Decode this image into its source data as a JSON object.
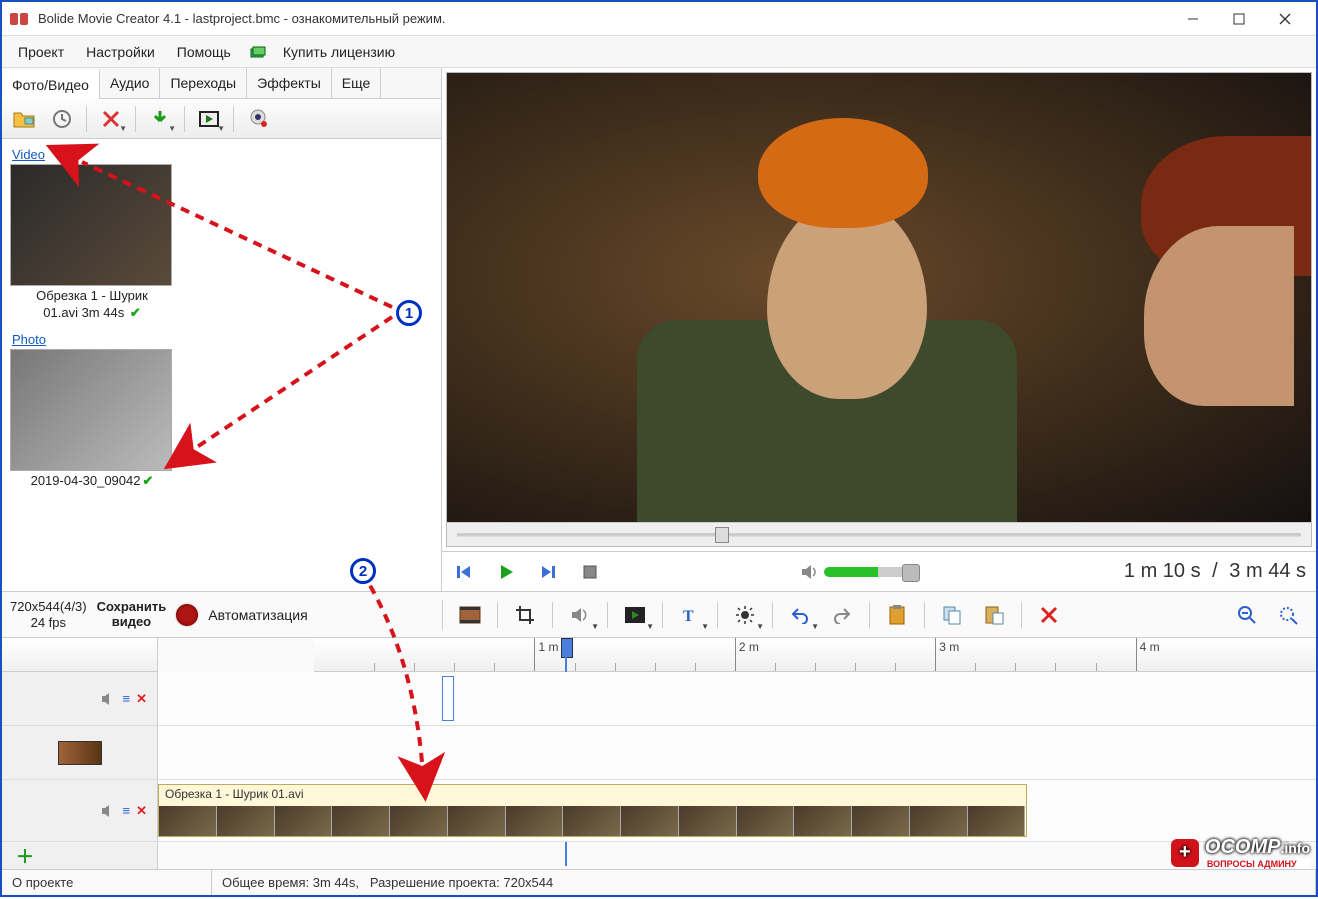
{
  "title": "Bolide Movie Creator 4.1 - lastproject.bmc  - ознакомительный режим.",
  "menu": {
    "project": "Проект",
    "settings": "Настройки",
    "help": "Помощь",
    "buy": "Купить лицензию"
  },
  "tabs": {
    "photo_video": "Фото/Видео",
    "audio": "Аудио",
    "transitions": "Переходы",
    "effects": "Эффекты",
    "more": "Еще"
  },
  "media": {
    "video_header": "Video",
    "photo_header": "Photo",
    "video_item": {
      "line1": "Обрезка 1 - Шурик",
      "line2": "01.avi 3m 44s"
    },
    "photo_item": {
      "caption": "2019-04-30_09042"
    }
  },
  "playback": {
    "current": "1 m 10 s",
    "sep": "/",
    "total": "3 m 44 s"
  },
  "project_info": {
    "res": "720x544(4/3)",
    "fps": "24 fps",
    "save": "Сохранить\nвидео",
    "auto": "Автоматизация"
  },
  "ruler": {
    "m1": "1 m",
    "m2": "2 m",
    "m3": "3 m",
    "m4": "4 m"
  },
  "timeline_clip": "Обрезка 1 - Шурик 01.avi",
  "status": {
    "about": "О проекте",
    "total": "Общее время: 3m 44s,",
    "res": "Разрешение проекта:   720x544"
  },
  "annotations": {
    "n1": "1",
    "n2": "2"
  },
  "watermark": {
    "brand": "OCOMP",
    "tld": ".info",
    "sub": "ВОПРОСЫ АДМИНУ"
  }
}
